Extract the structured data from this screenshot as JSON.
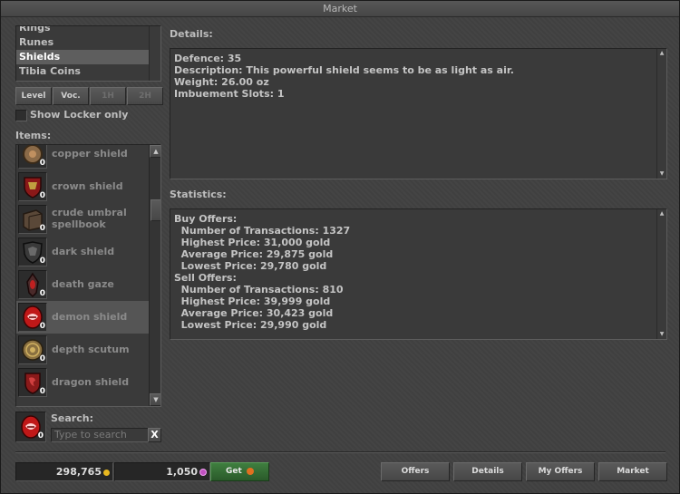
{
  "window": {
    "title": "Market"
  },
  "categories": [
    {
      "label": "Rings",
      "selected": false
    },
    {
      "label": "Runes",
      "selected": false
    },
    {
      "label": "Shields",
      "selected": true
    },
    {
      "label": "Tibia Coins",
      "selected": false
    }
  ],
  "filters": {
    "level": "Level",
    "voc": "Voc.",
    "one_hand": "1H",
    "two_hand": "2H"
  },
  "show_locker": {
    "label": "Show Locker only",
    "checked": false
  },
  "items_label": "Items:",
  "items": [
    {
      "name": "copper shield",
      "count": "0",
      "icon": "copper-shield-icon"
    },
    {
      "name": "crown shield",
      "count": "0",
      "icon": "crown-shield-icon"
    },
    {
      "name": "crude umbral spellbook",
      "count": "0",
      "icon": "crude-umbral-spellbook-icon"
    },
    {
      "name": "dark shield",
      "count": "0",
      "icon": "dark-shield-icon"
    },
    {
      "name": "death gaze",
      "count": "0",
      "icon": "death-gaze-icon"
    },
    {
      "name": "demon shield",
      "count": "0",
      "icon": "demon-shield-icon",
      "selected": true
    },
    {
      "name": "depth scutum",
      "count": "0",
      "icon": "depth-scutum-icon"
    },
    {
      "name": "dragon shield",
      "count": "0",
      "icon": "dragon-shield-icon"
    }
  ],
  "selected_item": {
    "count": "0",
    "icon": "demon-shield-icon"
  },
  "search": {
    "label": "Search:",
    "placeholder": "Type to search",
    "clear": "X"
  },
  "details": {
    "label": "Details:",
    "lines": [
      "Defence: 35",
      "Description: This powerful shield seems to be as light as air.",
      "Weight: 26.00 oz",
      "Imbuement Slots: 1"
    ]
  },
  "statistics": {
    "label": "Statistics:",
    "lines": [
      "Buy Offers:",
      "  Number of Transactions: 1327",
      "  Highest Price: 31,000 gold",
      "  Average Price: 29,875 gold",
      "  Lowest Price: 29,780 gold",
      "Sell Offers:",
      "  Number of Transactions: 810",
      "  Highest Price: 39,999 gold",
      "  Average Price: 30,423 gold",
      "  Lowest Price: 29,990 gold"
    ]
  },
  "footer": {
    "gold": "298,765",
    "coins": "1,050",
    "get_label": "Get",
    "buttons": {
      "offers": "Offers",
      "details": "Details",
      "my_offers": "My Offers",
      "market": "Market"
    }
  },
  "colors": {
    "gold_coin": "#e8b820",
    "tibia_coin": "#c050c0",
    "get_green": "#3f7f3f"
  }
}
